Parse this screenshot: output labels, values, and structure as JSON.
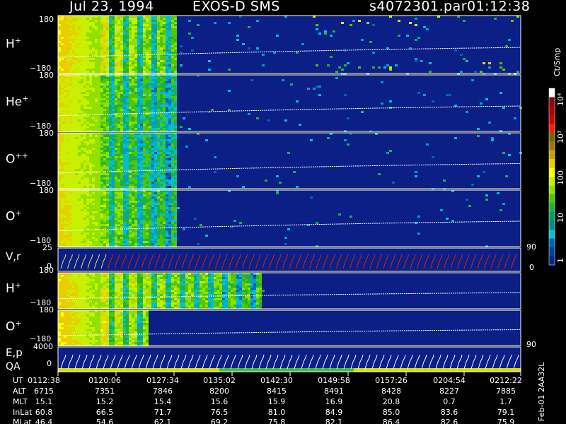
{
  "header": {
    "date": "Jul 23, 1994",
    "mission": "EXOS-D SMS",
    "file": "s4072301.par",
    "time": "01:12:38"
  },
  "panels": [
    {
      "species": "H",
      "charge": "+",
      "ymax": "180",
      "ymin": "−180"
    },
    {
      "species": "He",
      "charge": "+",
      "ymax": "180",
      "ymin": "−180"
    },
    {
      "species": "O",
      "charge": "++",
      "ymax": "180",
      "ymin": "−180"
    },
    {
      "species": "O",
      "charge": "+",
      "ymax": "180",
      "ymin": "−180"
    },
    {
      "species": "V,r",
      "charge": "",
      "ymax": "25",
      "ymin": "0",
      "right_top": "90",
      "right_bottom": "0"
    },
    {
      "species": "H",
      "charge": "+",
      "ymax": "180",
      "ymin": "−180"
    },
    {
      "species": "O",
      "charge": "+",
      "ymax": "180",
      "ymin": "−180"
    },
    {
      "species": "E,p",
      "species2": "QA",
      "ymax": "4000",
      "ymin": "0",
      "right_top": "90"
    }
  ],
  "colorbar": {
    "unit": "Ct/Smp",
    "ticks": [
      "10⁴",
      "10³",
      "100",
      "10",
      "1"
    ],
    "colors": [
      "#ffffff",
      "#9a0000",
      "#b00000",
      "#d00000",
      "#ff1a00",
      "#806000",
      "#a07800",
      "#c8a000",
      "#e8d000",
      "#ffff00",
      "#c8f000",
      "#90e000",
      "#50c800",
      "#20b040",
      "#00a060",
      "#008c8c",
      "#00c0d0",
      "#0064b4",
      "#0040a0",
      "#002890"
    ]
  },
  "footer": {
    "labels": [
      "UT",
      "ALT",
      "MLT",
      "InLat",
      "MLat"
    ],
    "rows": [
      [
        "0112:38",
        "0120:06",
        "0127:34",
        "0135:02",
        "0142:30",
        "0149:58",
        "0157:26",
        "0204:54",
        "0212:22"
      ],
      [
        "6715",
        "7351",
        "7846",
        "8200",
        "8415",
        "8491",
        "8428",
        "8227",
        "7885"
      ],
      [
        "15.1",
        "15.2",
        "15.4",
        "15.6",
        "15.9",
        "16.9",
        "20.8",
        "0.7",
        "1.7"
      ],
      [
        "60.8",
        "66.5",
        "71.7",
        "76.5",
        "81.0",
        "84.9",
        "85.0",
        "83.6",
        "79.1"
      ],
      [
        "46.4",
        "54.6",
        "62.1",
        "69.2",
        "75.8",
        "82.1",
        "86.4",
        "82.6",
        "75.9"
      ]
    ],
    "side_note": "Feb-01 2AA32L"
  },
  "chart_data": {
    "type": "heatmap",
    "title": "Jul 23, 1994  EXOS-D SMS",
    "x_label": "UT",
    "x_ticks": [
      "0112:38",
      "0120:06",
      "0127:34",
      "0135:02",
      "0142:30",
      "0149:58",
      "0157:26",
      "0204:54",
      "0212:22"
    ],
    "y_range_pitch_angle": [
      -180,
      180
    ],
    "colorbar_unit": "Ct/Smp",
    "colorbar_ticks": [
      "1",
      "10",
      "100",
      "10³",
      "10⁴"
    ],
    "panels": [
      "H+",
      "He+",
      "O++",
      "O+",
      "V,r",
      "H+",
      "O+",
      "E,p QA"
    ]
  }
}
